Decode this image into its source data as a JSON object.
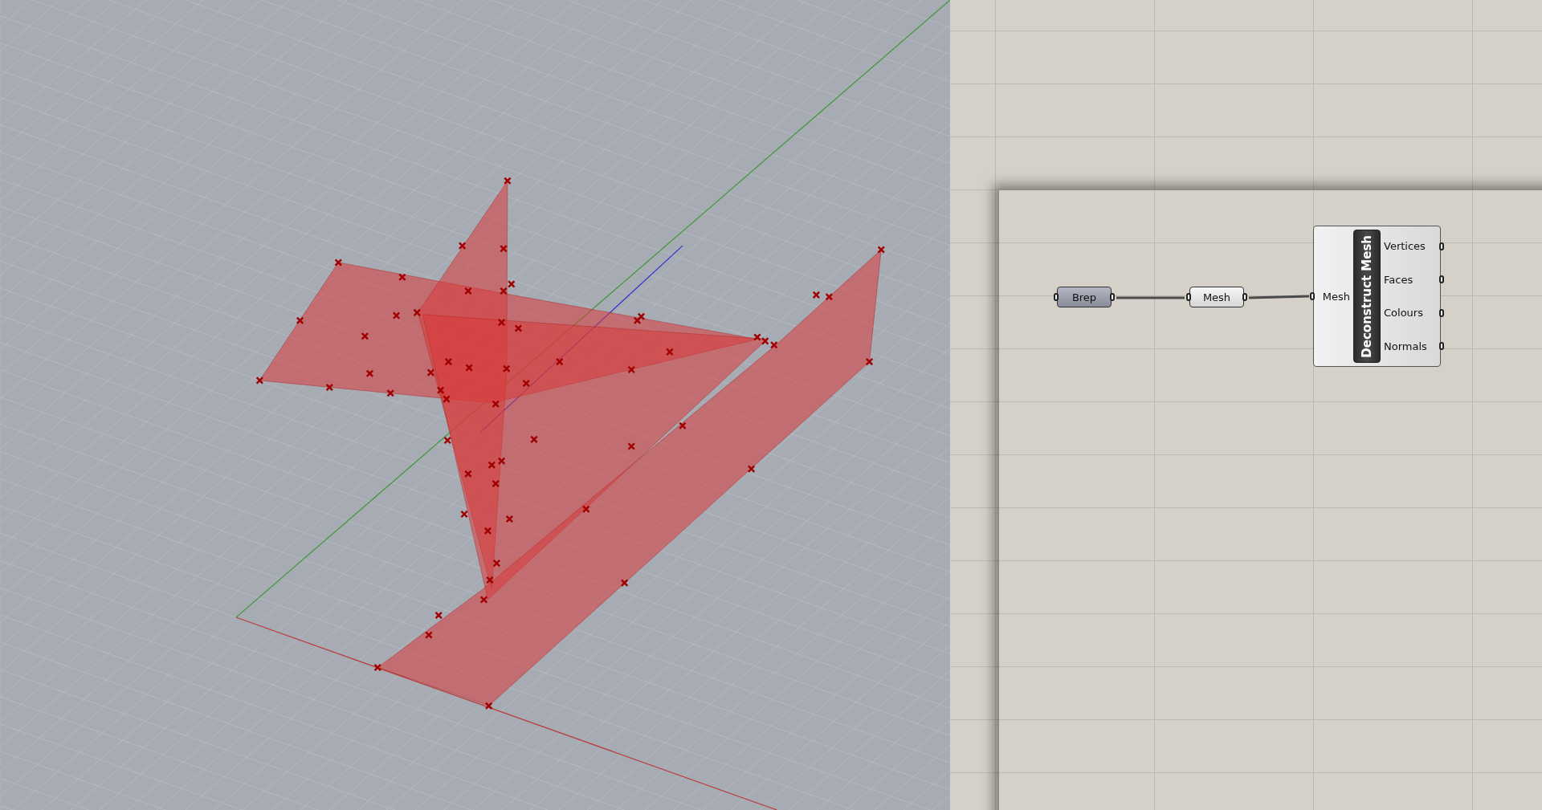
{
  "canvas": {
    "params": [
      {
        "label": "Brep",
        "kind": "brep"
      },
      {
        "label": "Mesh",
        "kind": "mesh"
      }
    ],
    "component": {
      "name": "Deconstruct Mesh",
      "inputs": [
        "Mesh"
      ],
      "outputs": [
        "Vertices",
        "Faces",
        "Colours",
        "Normals"
      ]
    }
  }
}
